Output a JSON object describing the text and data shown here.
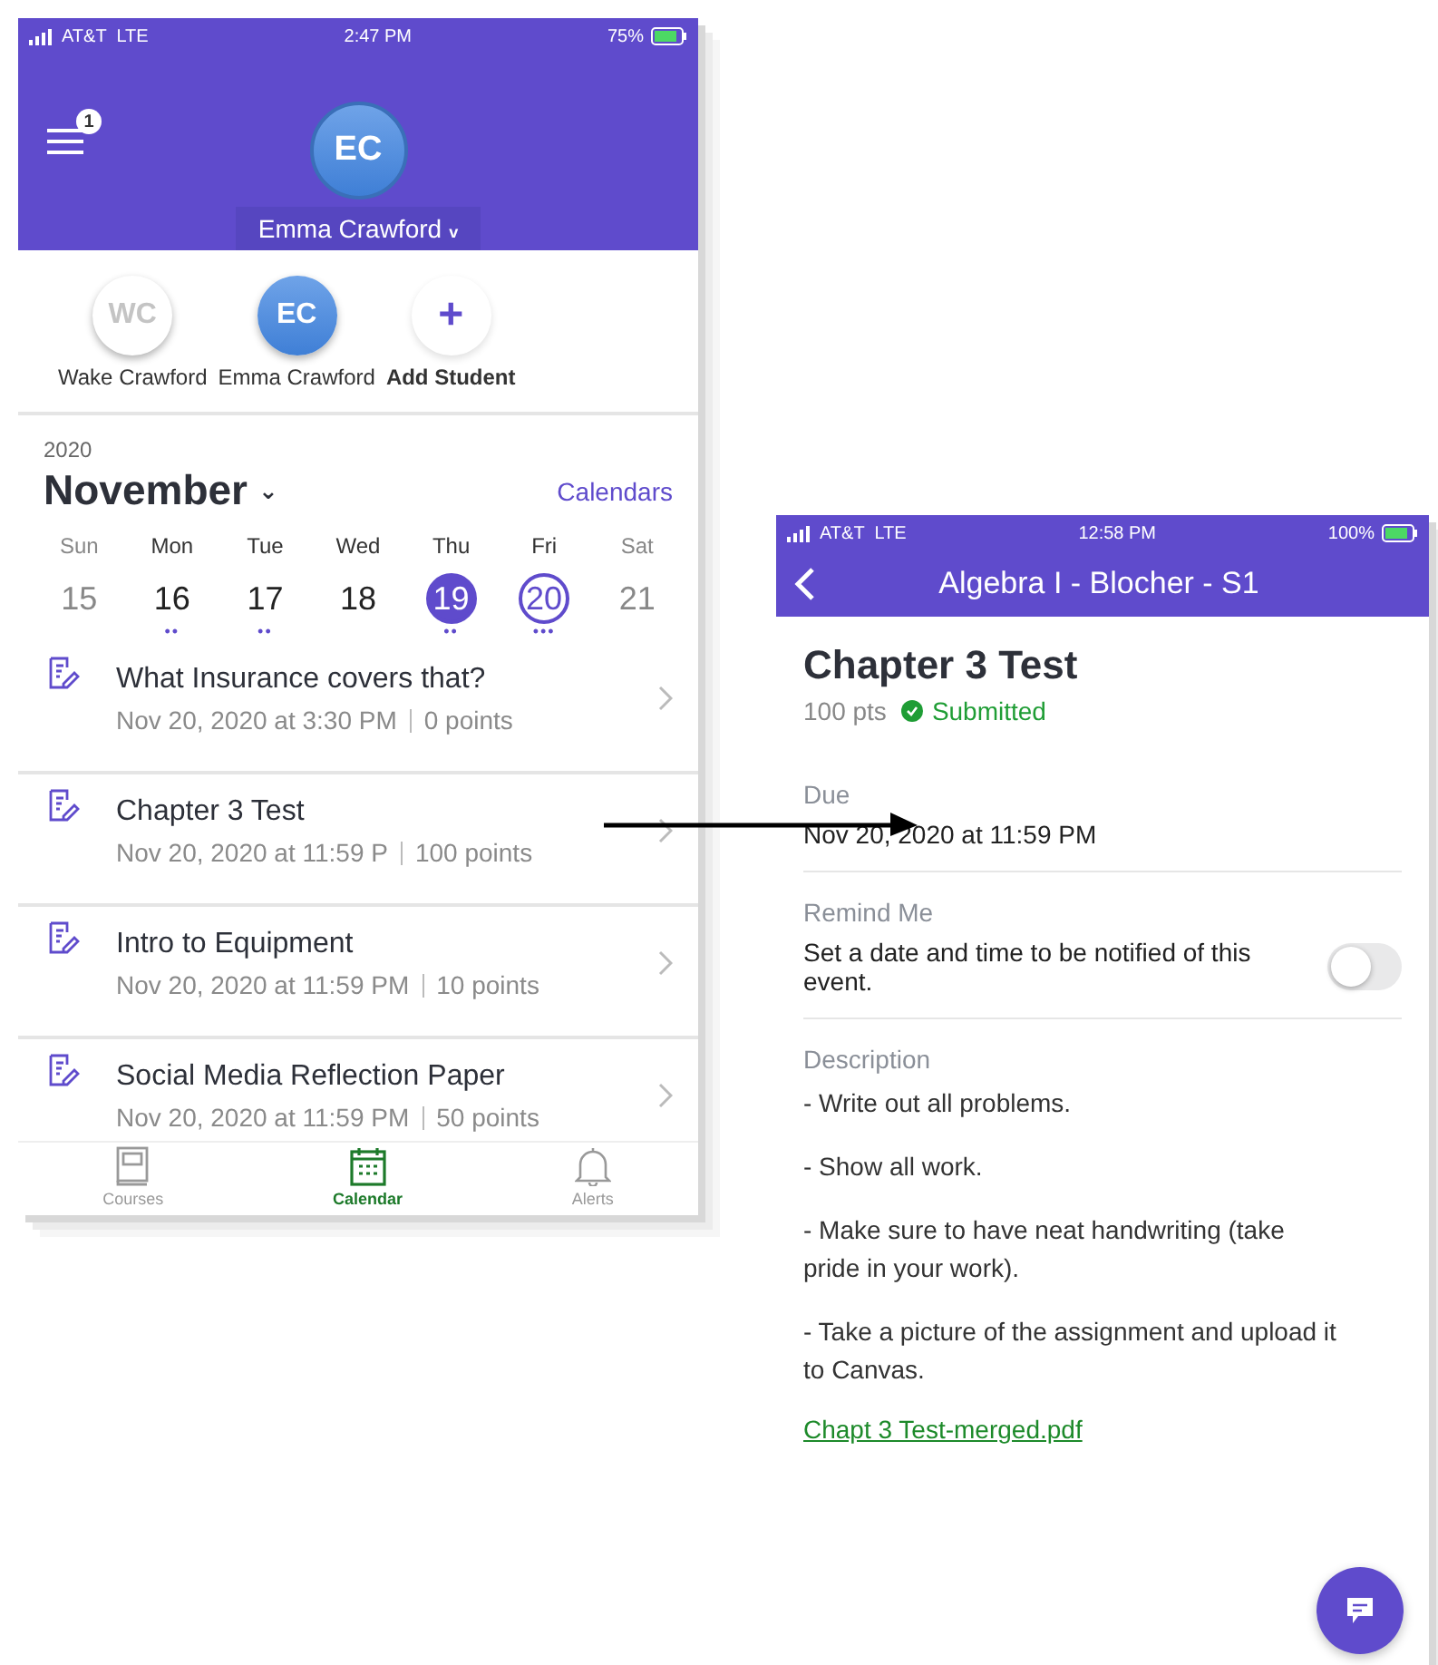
{
  "left_phone": {
    "status_bar": {
      "carrier": "AT&T  LTE",
      "time": "2:47 PM",
      "battery": "75%"
    },
    "header": {
      "menu_badge": "1",
      "avatar": "EC",
      "student_name": "Emma Crawford",
      "caret": "v"
    },
    "students": [
      {
        "initials": "WC",
        "name": "Wake Crawford",
        "kind": "student",
        "selected": false
      },
      {
        "initials": "EC",
        "name": "Emma Crawford",
        "kind": "student",
        "selected": true
      },
      {
        "initials": "+",
        "name": "Add Student",
        "kind": "add",
        "selected": false
      }
    ],
    "calendar": {
      "year": "2020",
      "month": "November",
      "caret": "⌄",
      "calendars_link": "Calendars",
      "days": [
        {
          "weekday": "Sun",
          "date": "15",
          "muted": true,
          "selected": false,
          "today": false
        },
        {
          "weekday": "Mon",
          "date": "16",
          "muted": false,
          "selected": false,
          "today": false,
          "dots": "••"
        },
        {
          "weekday": "Tue",
          "date": "17",
          "muted": false,
          "selected": false,
          "today": false,
          "dots": "••"
        },
        {
          "weekday": "Wed",
          "date": "18",
          "muted": false,
          "selected": false,
          "today": false
        },
        {
          "weekday": "Thu",
          "date": "19",
          "muted": false,
          "selected": true,
          "today": false,
          "dots": "••"
        },
        {
          "weekday": "Fri",
          "date": "20",
          "muted": false,
          "selected": false,
          "today": true,
          "dots": "•••"
        },
        {
          "weekday": "Sat",
          "date": "21",
          "muted": true,
          "selected": false,
          "today": false
        }
      ]
    },
    "assignments": [
      {
        "title": "What Insurance covers that?",
        "due": "Nov 20, 2020 at 3:30 PM",
        "points": "0 points"
      },
      {
        "title": "Chapter 3 Test",
        "due": "Nov 20, 2020 at 11:59 P",
        "points": "100 points"
      },
      {
        "title": "Intro to Equipment",
        "due": "Nov 20, 2020 at 11:59 PM",
        "points": "10 points"
      },
      {
        "title": "Social Media Reflection Paper",
        "due": "Nov 20, 2020 at 11:59 PM",
        "points": "50 points"
      }
    ],
    "tab_bar": [
      {
        "label": "Courses",
        "kind": "courses",
        "selected": false
      },
      {
        "label": "Calendar",
        "kind": "calendar",
        "selected": true
      },
      {
        "label": "Alerts",
        "kind": "alerts",
        "selected": false
      }
    ]
  },
  "right_phone": {
    "status_bar": {
      "carrier": "AT&T  LTE",
      "time": "12:58 PM",
      "battery": "100%"
    },
    "header": {
      "title": "Algebra I - Blocher - S1"
    },
    "assignment": {
      "title": "Chapter 3 Test",
      "points": "100 pts",
      "status": "Submitted",
      "submitted": true
    },
    "due": {
      "label": "Due",
      "value": "Nov 20, 2020 at 11:59 PM"
    },
    "remind": {
      "label": "Remind Me",
      "text": "Set a date and time to be notified of this event.",
      "on": false
    },
    "description": {
      "label": "Description",
      "paragraphs": [
        "- Write out all problems.",
        "- Show all work.",
        "- Make sure to have neat handwriting (take pride in your work).",
        "- Take a picture of the assignment and upload it to Canvas."
      ],
      "attachment": "Chapt 3 Test-merged.pdf"
    }
  }
}
